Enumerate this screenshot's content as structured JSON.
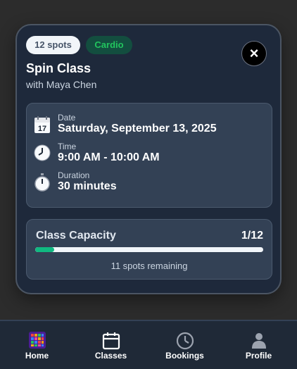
{
  "modal": {
    "spots_badge": "12 spots",
    "category_badge": "Cardio",
    "close_label": "×",
    "title": "Spin Class",
    "instructor": "with Maya Chen",
    "details": {
      "date_label": "Date",
      "date_value": "Saturday, September 13, 2025",
      "time_label": "Time",
      "time_value": "9:00 AM - 10:00 AM",
      "duration_label": "Duration",
      "duration_value": "30 minutes"
    },
    "capacity": {
      "title": "Class Capacity",
      "count": "1/12",
      "fill_fraction": 0.083,
      "remaining": "11 spots remaining"
    }
  },
  "nav": {
    "items": [
      {
        "label": "Home",
        "icon": "home-grid-icon"
      },
      {
        "label": "Classes",
        "icon": "calendar-icon"
      },
      {
        "label": "Bookings",
        "icon": "clock-icon"
      },
      {
        "label": "Profile",
        "icon": "person-icon"
      }
    ]
  },
  "colors": {
    "accent_green": "#10b981",
    "card_bg": "#1e293b",
    "panel_bg": "#334155"
  }
}
